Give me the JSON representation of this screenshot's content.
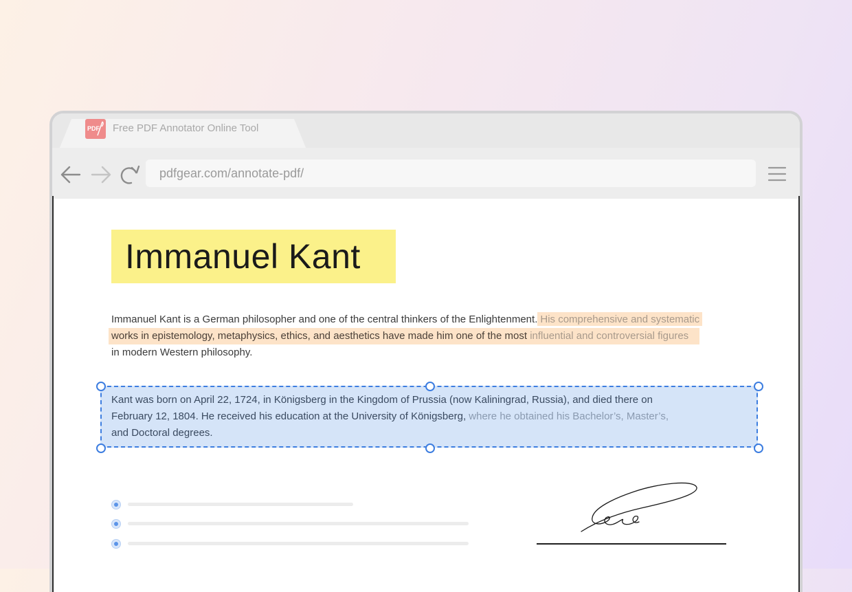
{
  "tab": {
    "title": "Free PDF Annotator Online Tool",
    "icon": "pdf-icon",
    "icon_label": "PDF"
  },
  "nav": {
    "url": "pdfgear.com/annotate-pdf/"
  },
  "document": {
    "title": "Immanuel Kant",
    "para1": {
      "line1_plain": "Immanuel Kant is a German philosopher and one of the central thinkers of the Enlightenment.",
      "line1_highlight": "His comprehensive and systematic",
      "line2_highlight_dark": "works in epistemology, metaphysics, ethics, and aesthetics have made him one of the most",
      "line2_highlight_light": " influential and controversial figures",
      "line3": "in modern Western philosophy."
    },
    "para2": {
      "line1": "Kant was born on April 22, 1724, in Königsberg in the Kingdom of Prussia (now Kaliningrad, Russia), and died there on",
      "line2_dark": "February 12, 1804. He received his education at the University of Königsberg,",
      "line2_fade": " where he obtained his Bachelor’s, Master’s,",
      "line3": "and Doctoral degrees."
    }
  },
  "colors": {
    "title_highlight": "#fbf18a",
    "text_highlight": "#fde3c8",
    "selection": "#d5e4f8",
    "selection_border": "#3c7de0"
  }
}
